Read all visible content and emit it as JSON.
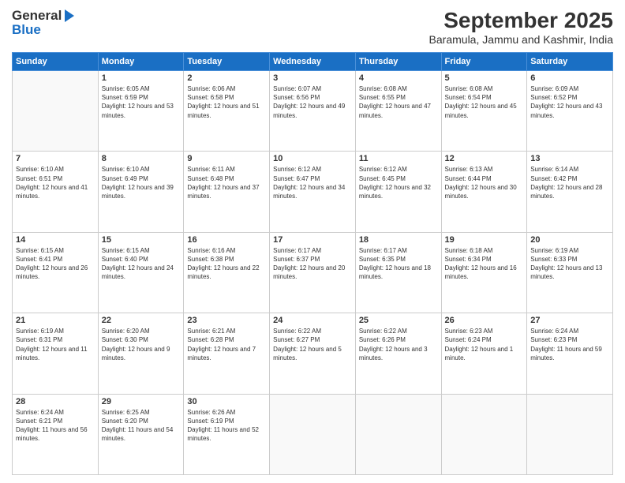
{
  "header": {
    "logo_general": "General",
    "logo_blue": "Blue",
    "month_title": "September 2025",
    "location": "Baramula, Jammu and Kashmir, India"
  },
  "weekdays": [
    "Sunday",
    "Monday",
    "Tuesday",
    "Wednesday",
    "Thursday",
    "Friday",
    "Saturday"
  ],
  "weeks": [
    [
      {
        "day": "",
        "sunrise": "",
        "sunset": "",
        "daylight": ""
      },
      {
        "day": "1",
        "sunrise": "Sunrise: 6:05 AM",
        "sunset": "Sunset: 6:59 PM",
        "daylight": "Daylight: 12 hours and 53 minutes."
      },
      {
        "day": "2",
        "sunrise": "Sunrise: 6:06 AM",
        "sunset": "Sunset: 6:58 PM",
        "daylight": "Daylight: 12 hours and 51 minutes."
      },
      {
        "day": "3",
        "sunrise": "Sunrise: 6:07 AM",
        "sunset": "Sunset: 6:56 PM",
        "daylight": "Daylight: 12 hours and 49 minutes."
      },
      {
        "day": "4",
        "sunrise": "Sunrise: 6:08 AM",
        "sunset": "Sunset: 6:55 PM",
        "daylight": "Daylight: 12 hours and 47 minutes."
      },
      {
        "day": "5",
        "sunrise": "Sunrise: 6:08 AM",
        "sunset": "Sunset: 6:54 PM",
        "daylight": "Daylight: 12 hours and 45 minutes."
      },
      {
        "day": "6",
        "sunrise": "Sunrise: 6:09 AM",
        "sunset": "Sunset: 6:52 PM",
        "daylight": "Daylight: 12 hours and 43 minutes."
      }
    ],
    [
      {
        "day": "7",
        "sunrise": "Sunrise: 6:10 AM",
        "sunset": "Sunset: 6:51 PM",
        "daylight": "Daylight: 12 hours and 41 minutes."
      },
      {
        "day": "8",
        "sunrise": "Sunrise: 6:10 AM",
        "sunset": "Sunset: 6:49 PM",
        "daylight": "Daylight: 12 hours and 39 minutes."
      },
      {
        "day": "9",
        "sunrise": "Sunrise: 6:11 AM",
        "sunset": "Sunset: 6:48 PM",
        "daylight": "Daylight: 12 hours and 37 minutes."
      },
      {
        "day": "10",
        "sunrise": "Sunrise: 6:12 AM",
        "sunset": "Sunset: 6:47 PM",
        "daylight": "Daylight: 12 hours and 34 minutes."
      },
      {
        "day": "11",
        "sunrise": "Sunrise: 6:12 AM",
        "sunset": "Sunset: 6:45 PM",
        "daylight": "Daylight: 12 hours and 32 minutes."
      },
      {
        "day": "12",
        "sunrise": "Sunrise: 6:13 AM",
        "sunset": "Sunset: 6:44 PM",
        "daylight": "Daylight: 12 hours and 30 minutes."
      },
      {
        "day": "13",
        "sunrise": "Sunrise: 6:14 AM",
        "sunset": "Sunset: 6:42 PM",
        "daylight": "Daylight: 12 hours and 28 minutes."
      }
    ],
    [
      {
        "day": "14",
        "sunrise": "Sunrise: 6:15 AM",
        "sunset": "Sunset: 6:41 PM",
        "daylight": "Daylight: 12 hours and 26 minutes."
      },
      {
        "day": "15",
        "sunrise": "Sunrise: 6:15 AM",
        "sunset": "Sunset: 6:40 PM",
        "daylight": "Daylight: 12 hours and 24 minutes."
      },
      {
        "day": "16",
        "sunrise": "Sunrise: 6:16 AM",
        "sunset": "Sunset: 6:38 PM",
        "daylight": "Daylight: 12 hours and 22 minutes."
      },
      {
        "day": "17",
        "sunrise": "Sunrise: 6:17 AM",
        "sunset": "Sunset: 6:37 PM",
        "daylight": "Daylight: 12 hours and 20 minutes."
      },
      {
        "day": "18",
        "sunrise": "Sunrise: 6:17 AM",
        "sunset": "Sunset: 6:35 PM",
        "daylight": "Daylight: 12 hours and 18 minutes."
      },
      {
        "day": "19",
        "sunrise": "Sunrise: 6:18 AM",
        "sunset": "Sunset: 6:34 PM",
        "daylight": "Daylight: 12 hours and 16 minutes."
      },
      {
        "day": "20",
        "sunrise": "Sunrise: 6:19 AM",
        "sunset": "Sunset: 6:33 PM",
        "daylight": "Daylight: 12 hours and 13 minutes."
      }
    ],
    [
      {
        "day": "21",
        "sunrise": "Sunrise: 6:19 AM",
        "sunset": "Sunset: 6:31 PM",
        "daylight": "Daylight: 12 hours and 11 minutes."
      },
      {
        "day": "22",
        "sunrise": "Sunrise: 6:20 AM",
        "sunset": "Sunset: 6:30 PM",
        "daylight": "Daylight: 12 hours and 9 minutes."
      },
      {
        "day": "23",
        "sunrise": "Sunrise: 6:21 AM",
        "sunset": "Sunset: 6:28 PM",
        "daylight": "Daylight: 12 hours and 7 minutes."
      },
      {
        "day": "24",
        "sunrise": "Sunrise: 6:22 AM",
        "sunset": "Sunset: 6:27 PM",
        "daylight": "Daylight: 12 hours and 5 minutes."
      },
      {
        "day": "25",
        "sunrise": "Sunrise: 6:22 AM",
        "sunset": "Sunset: 6:26 PM",
        "daylight": "Daylight: 12 hours and 3 minutes."
      },
      {
        "day": "26",
        "sunrise": "Sunrise: 6:23 AM",
        "sunset": "Sunset: 6:24 PM",
        "daylight": "Daylight: 12 hours and 1 minute."
      },
      {
        "day": "27",
        "sunrise": "Sunrise: 6:24 AM",
        "sunset": "Sunset: 6:23 PM",
        "daylight": "Daylight: 11 hours and 59 minutes."
      }
    ],
    [
      {
        "day": "28",
        "sunrise": "Sunrise: 6:24 AM",
        "sunset": "Sunset: 6:21 PM",
        "daylight": "Daylight: 11 hours and 56 minutes."
      },
      {
        "day": "29",
        "sunrise": "Sunrise: 6:25 AM",
        "sunset": "Sunset: 6:20 PM",
        "daylight": "Daylight: 11 hours and 54 minutes."
      },
      {
        "day": "30",
        "sunrise": "Sunrise: 6:26 AM",
        "sunset": "Sunset: 6:19 PM",
        "daylight": "Daylight: 11 hours and 52 minutes."
      },
      {
        "day": "",
        "sunrise": "",
        "sunset": "",
        "daylight": ""
      },
      {
        "day": "",
        "sunrise": "",
        "sunset": "",
        "daylight": ""
      },
      {
        "day": "",
        "sunrise": "",
        "sunset": "",
        "daylight": ""
      },
      {
        "day": "",
        "sunrise": "",
        "sunset": "",
        "daylight": ""
      }
    ]
  ]
}
